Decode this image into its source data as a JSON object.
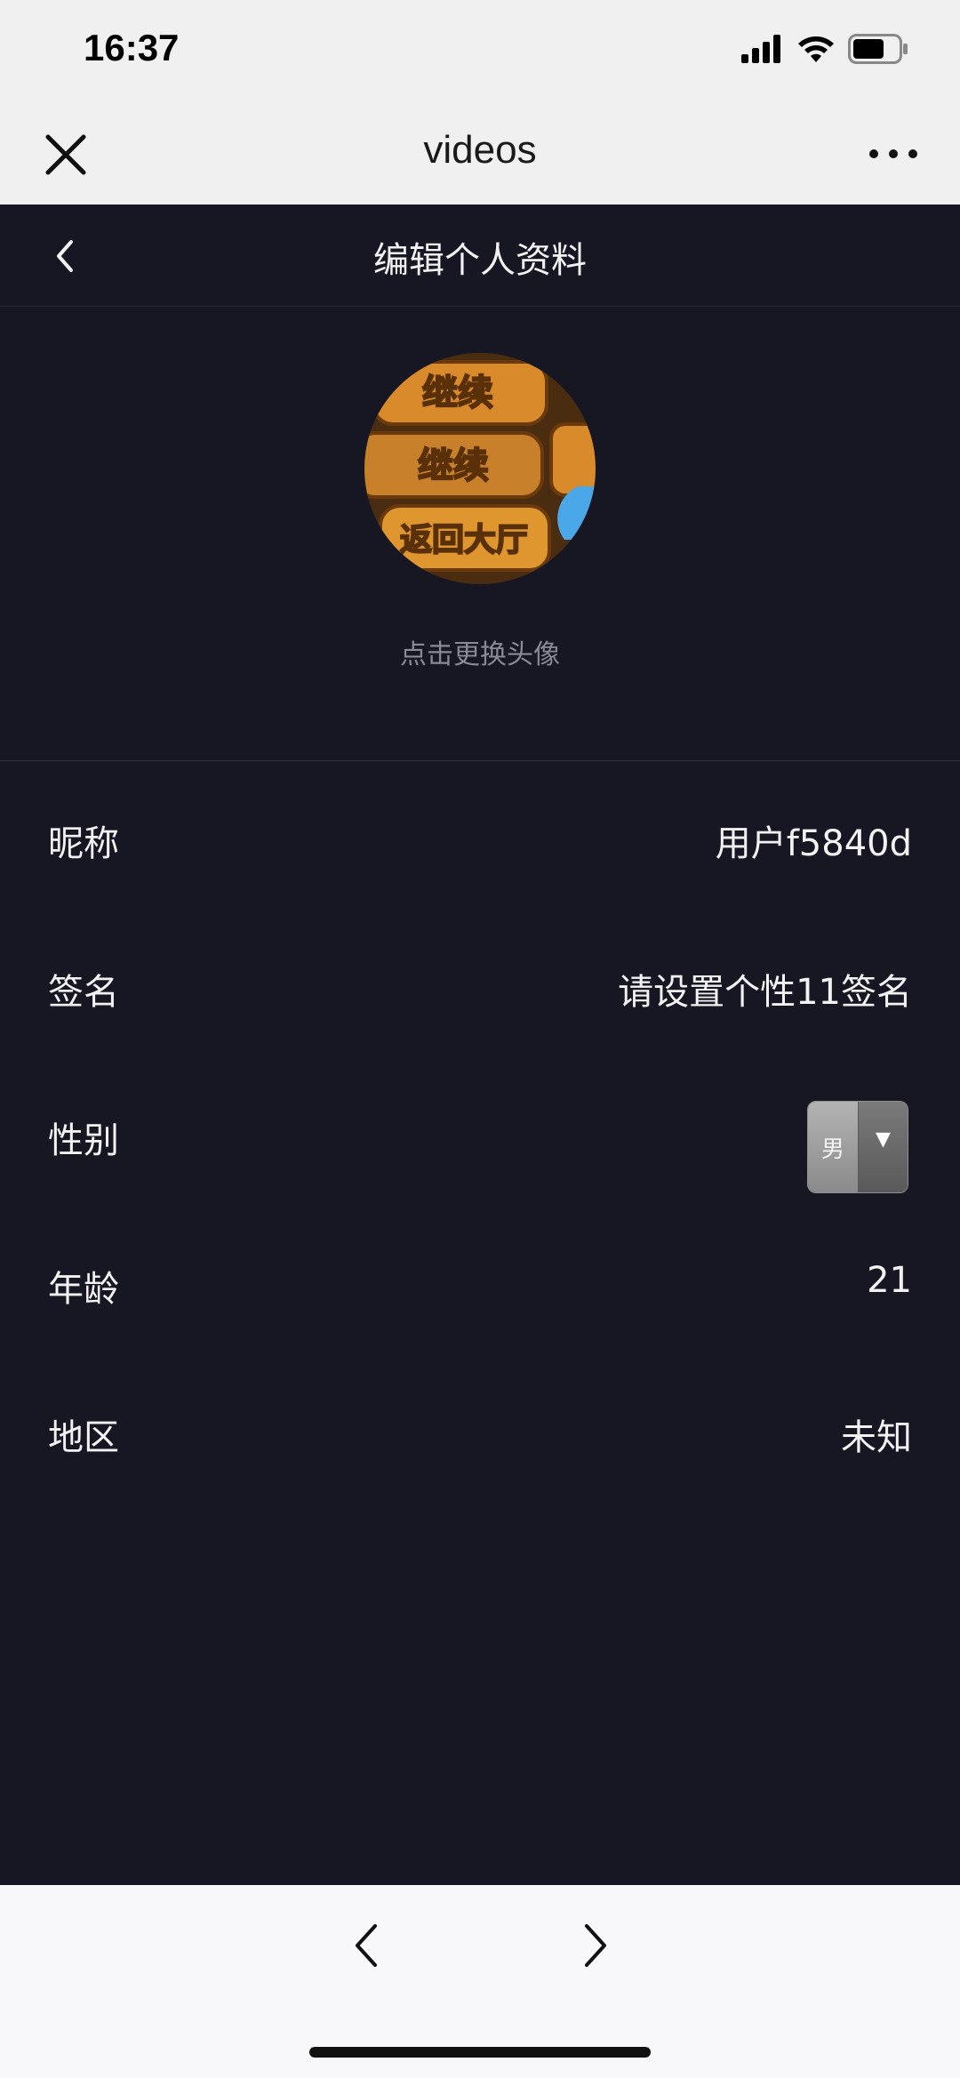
{
  "status_bar": {
    "time": "16:37",
    "battery_level": 0.6
  },
  "wechat_header": {
    "title": "videos",
    "close_icon": "close-icon",
    "more_icon": "more-icon"
  },
  "app_header": {
    "back_icon": "chevron-left-icon",
    "title": "编辑个人资料"
  },
  "avatar": {
    "hint": "点击更换头像",
    "image_texts": [
      "继续",
      "继续",
      "返回大厅"
    ]
  },
  "fields": [
    {
      "label": "昵称",
      "value": "用户f5840d"
    },
    {
      "label": "签名",
      "value": "请设置个性11签名"
    },
    {
      "label": "性别",
      "value": "男"
    },
    {
      "label": "年龄",
      "value": "21"
    },
    {
      "label": "地区",
      "value": "未知"
    }
  ],
  "bottom_nav": {
    "back_icon": "chevron-left-icon",
    "forward_icon": "chevron-right-icon"
  },
  "colors": {
    "background": "#171723",
    "header_bg": "#f0f0f0",
    "text": "#f2f2f2",
    "hint": "#8a8a94"
  }
}
